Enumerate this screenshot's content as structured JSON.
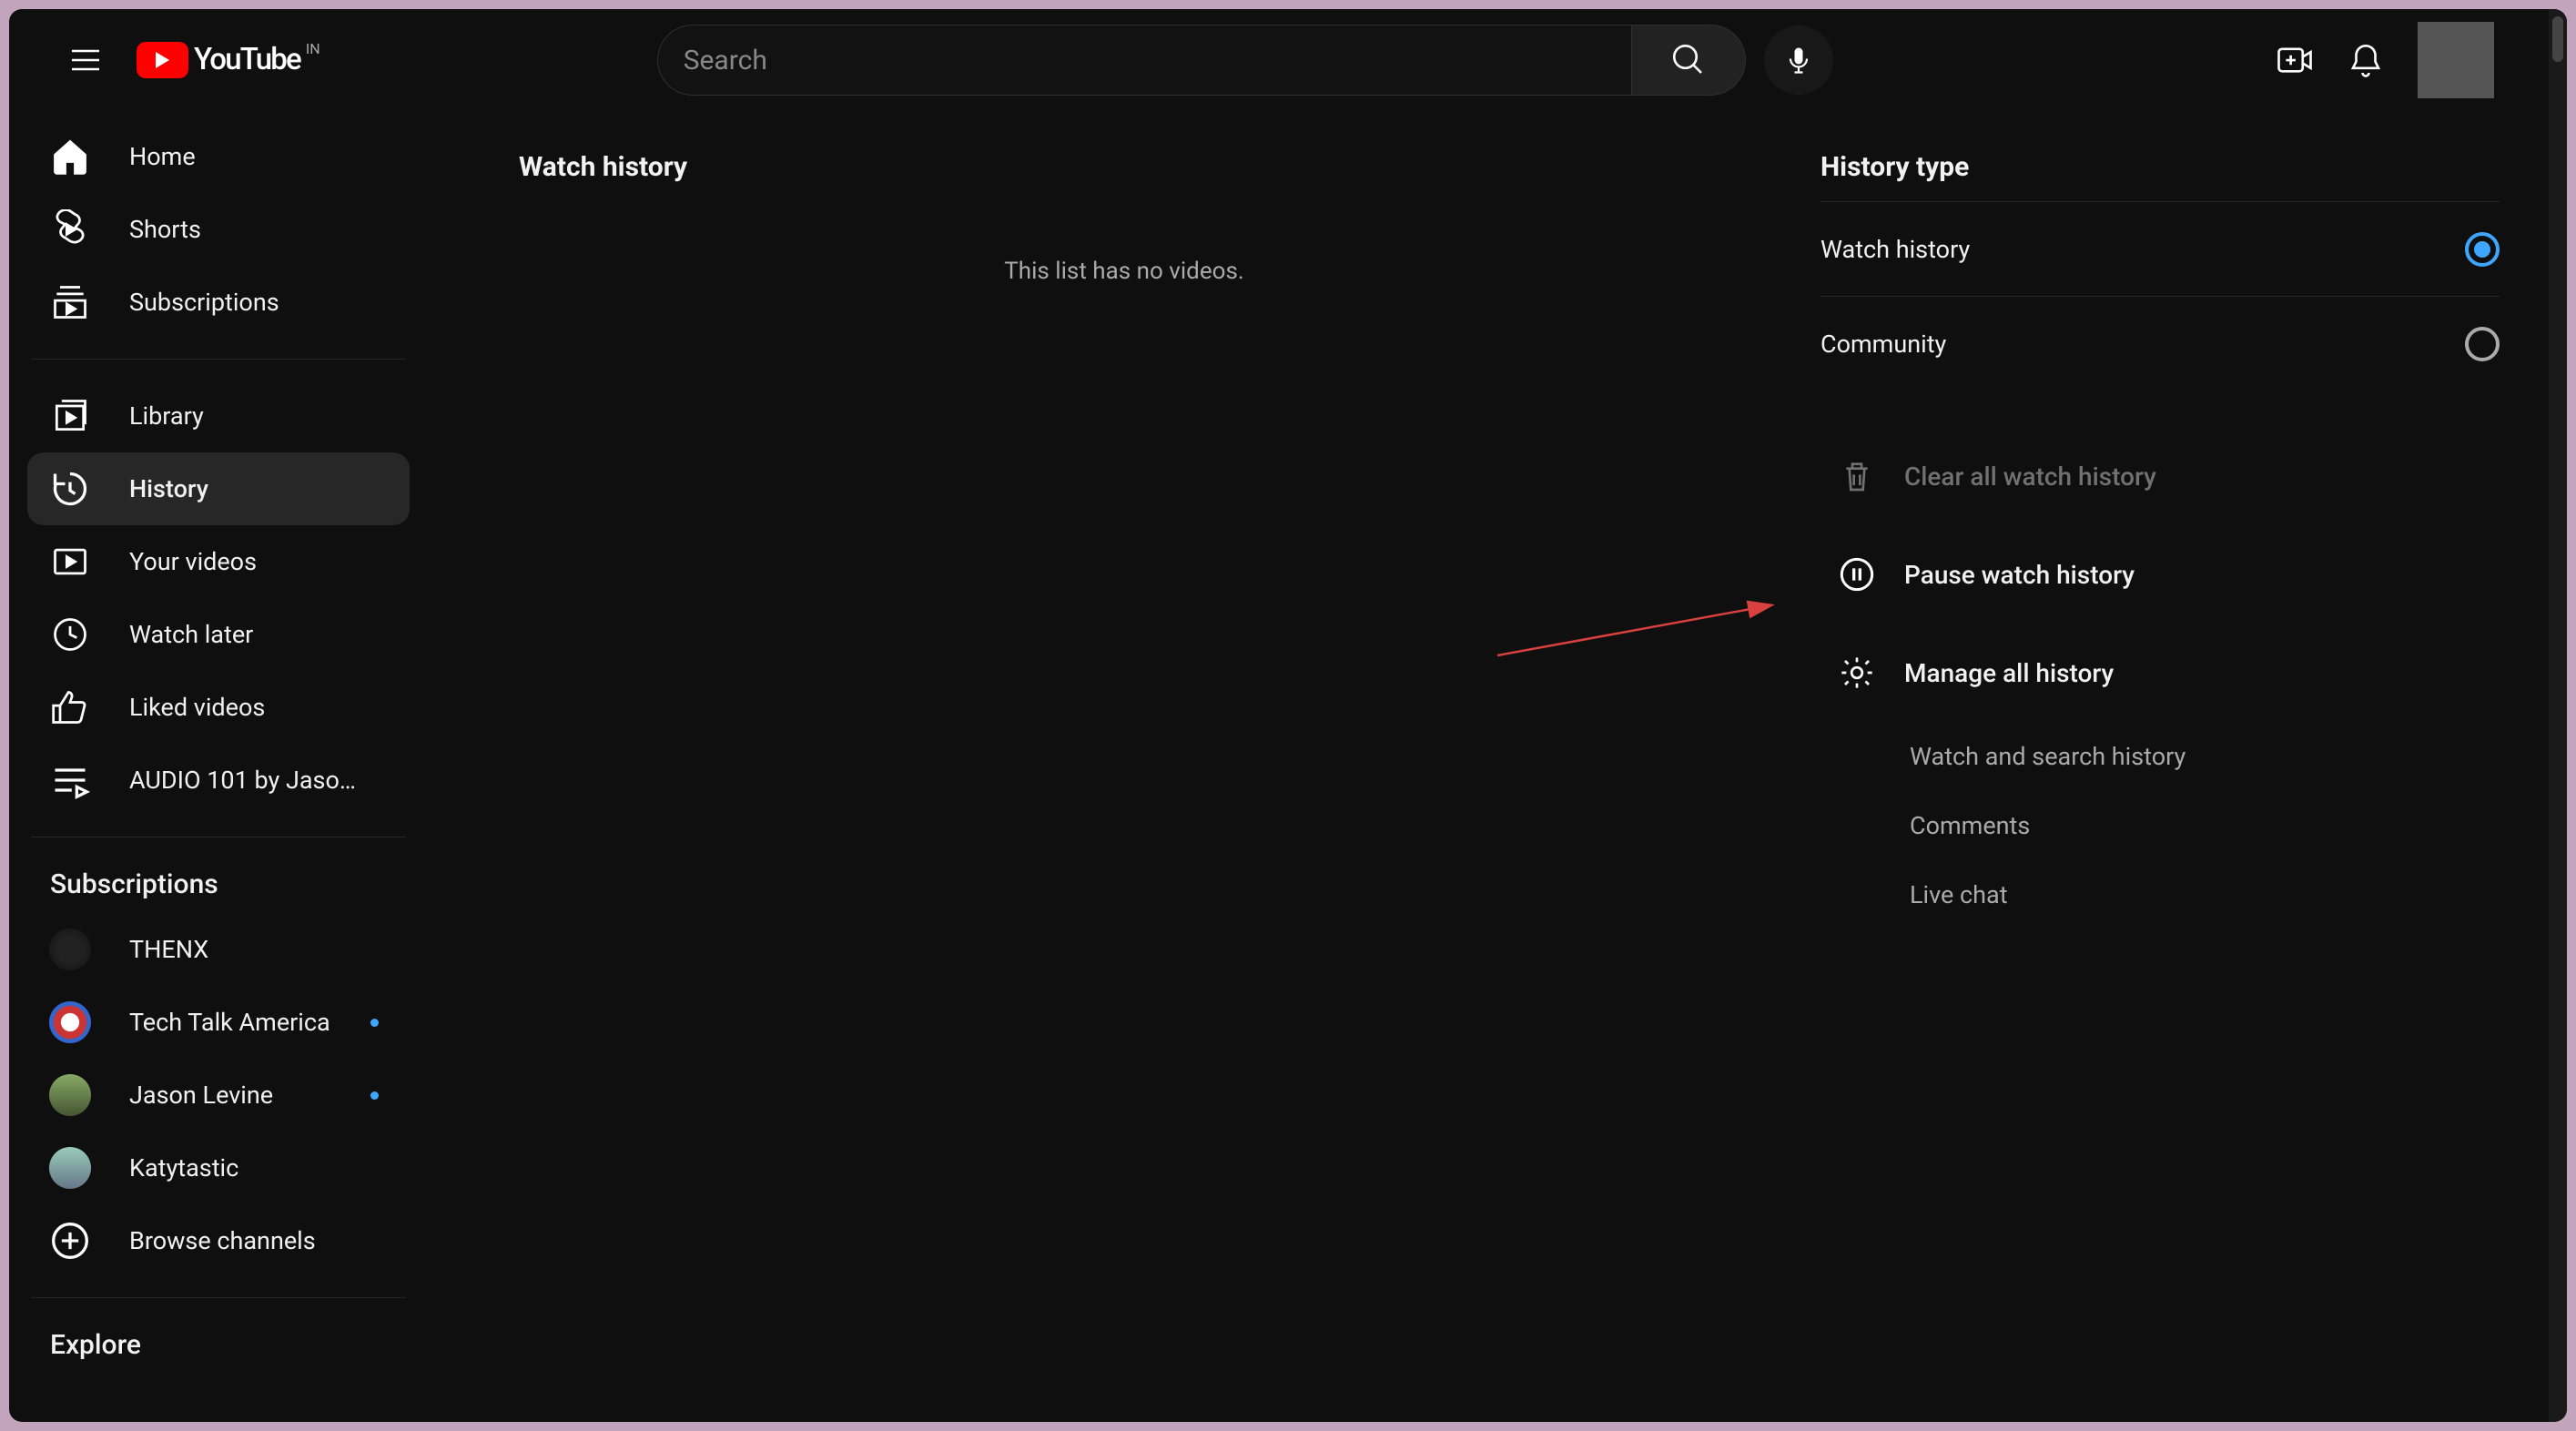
{
  "header": {
    "logo_text": "YouTube",
    "logo_region": "IN",
    "search_placeholder": "Search"
  },
  "sidebar": {
    "section1": [
      {
        "label": "Home"
      },
      {
        "label": "Shorts"
      },
      {
        "label": "Subscriptions"
      }
    ],
    "section2": [
      {
        "label": "Library"
      },
      {
        "label": "History",
        "active": true
      },
      {
        "label": "Your videos"
      },
      {
        "label": "Watch later"
      },
      {
        "label": "Liked videos"
      },
      {
        "label": "AUDIO 101 by Jaso…"
      }
    ],
    "subs_title": "Subscriptions",
    "subs": [
      {
        "label": "THENX",
        "dot": false
      },
      {
        "label": "Tech Talk America",
        "dot": true
      },
      {
        "label": "Jason Levine",
        "dot": true
      },
      {
        "label": "Katytastic",
        "dot": false
      }
    ],
    "browse_label": "Browse channels",
    "explore_title": "Explore"
  },
  "main": {
    "title": "Watch history",
    "empty_message": "This list has no videos."
  },
  "right": {
    "title": "History type",
    "types": [
      {
        "label": "Watch history",
        "selected": true
      },
      {
        "label": "Community",
        "selected": false
      }
    ],
    "actions": {
      "clear": "Clear all watch history",
      "pause": "Pause watch history",
      "manage": "Manage all history"
    },
    "sublinks": [
      "Watch and search history",
      "Comments",
      "Live chat"
    ]
  }
}
